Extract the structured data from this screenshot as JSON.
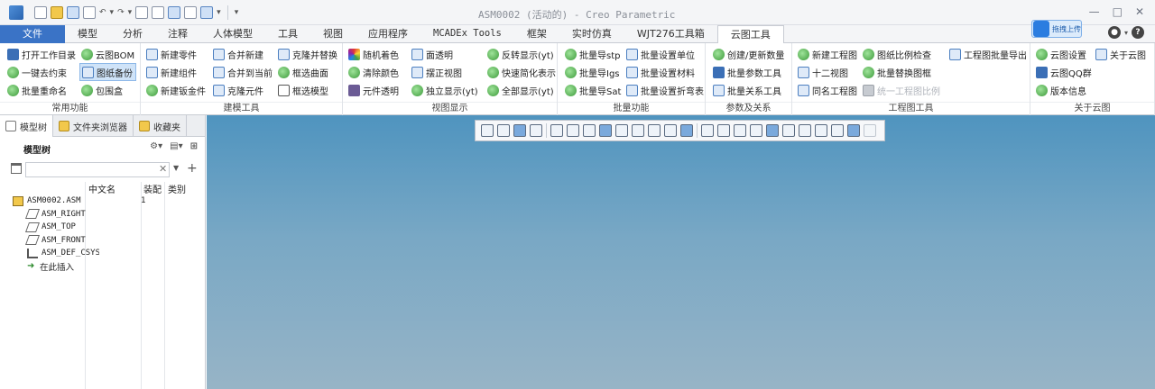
{
  "window": {
    "title": "ASM0002 (活动的) - Creo Parametric",
    "controls": [
      "—",
      "□",
      "✕"
    ]
  },
  "ribbon_tabs": [
    "文件",
    "模型",
    "分析",
    "注释",
    "人体模型",
    "工具",
    "视图",
    "应用程序",
    "MCADEx Tools",
    "框架",
    "实时仿真",
    "WJT276工具箱",
    "云图工具"
  ],
  "cloud_upload_label": "拖拽上传",
  "groups": [
    {
      "label": "常用功能",
      "cols": [
        [
          {
            "label": "打开工作目录",
            "icon": "bd"
          },
          {
            "label": "一键去约束",
            "icon": "g"
          },
          {
            "label": "批量重命名",
            "icon": "g"
          }
        ],
        [
          {
            "label": "云图BOM",
            "icon": "g"
          },
          {
            "label": "图纸备份",
            "icon": "bl",
            "selected": true
          },
          {
            "label": "包围盒",
            "icon": "g"
          }
        ]
      ]
    },
    {
      "label": "建模工具",
      "cols": [
        [
          {
            "label": "新建零件",
            "icon": "bl"
          },
          {
            "label": "新建组件",
            "icon": "bl"
          },
          {
            "label": "新建钣金件",
            "icon": "g"
          }
        ],
        [
          {
            "label": "合并新建",
            "icon": "bl"
          },
          {
            "label": "合并到当前",
            "icon": "bl"
          },
          {
            "label": "克隆元件",
            "icon": "bl"
          }
        ],
        [
          {
            "label": "克隆并替换",
            "icon": "bl"
          },
          {
            "label": "框选曲面",
            "icon": "g"
          },
          {
            "label": "框选模型",
            "icon": "pg"
          }
        ]
      ]
    },
    {
      "label": "视图显示",
      "cols": [
        [
          {
            "label": "随机着色",
            "icon": "rb"
          },
          {
            "label": "清除颜色",
            "icon": "g"
          },
          {
            "label": "元件透明",
            "icon": "pu"
          }
        ],
        [
          {
            "label": "面透明",
            "icon": "bl"
          },
          {
            "label": "摆正视图",
            "icon": "bl"
          },
          {
            "label": "独立显示(yt)",
            "icon": "g"
          }
        ],
        [
          {
            "label": "反转显示(yt)",
            "icon": "g"
          },
          {
            "label": "快速简化表示",
            "icon": "g"
          },
          {
            "label": "全部显示(yt)",
            "icon": "g"
          }
        ]
      ]
    },
    {
      "label": "批量功能",
      "cols": [
        [
          {
            "label": "批量导stp",
            "icon": "g"
          },
          {
            "label": "批量导Igs",
            "icon": "g"
          },
          {
            "label": "批量导Sat",
            "icon": "g"
          }
        ],
        [
          {
            "label": "批量设置单位",
            "icon": "bl"
          },
          {
            "label": "批量设置材料",
            "icon": "bl"
          },
          {
            "label": "批量设置折弯表",
            "icon": "bl"
          }
        ]
      ]
    },
    {
      "label": "参数及关系",
      "cols": [
        [
          {
            "label": "创建/更新数量",
            "icon": "g"
          },
          {
            "label": "批量参数工具",
            "icon": "bd"
          },
          {
            "label": "批量关系工具",
            "icon": "bl"
          }
        ]
      ]
    },
    {
      "label": "工程图工具",
      "cols": [
        [
          {
            "label": "新建工程图",
            "icon": "g"
          },
          {
            "label": "十二视图",
            "icon": "bl"
          },
          {
            "label": "同名工程图",
            "icon": "bl"
          }
        ],
        [
          {
            "label": "图纸比例检查",
            "icon": "g"
          },
          {
            "label": "批量替换图框",
            "icon": "g"
          },
          {
            "label": "统一工程图比例",
            "icon": "gr",
            "disabled": true
          }
        ],
        [
          {
            "label": "工程图批量导出",
            "icon": "bl"
          }
        ]
      ]
    },
    {
      "label": "关于云图",
      "cols": [
        [
          {
            "label": "云图设置",
            "icon": "g"
          },
          {
            "label": "云图QQ群",
            "icon": "bd"
          },
          {
            "label": "版本信息",
            "icon": "g"
          }
        ],
        [
          {
            "label": "关于云图",
            "icon": "bl"
          }
        ]
      ]
    }
  ],
  "panel_tabs": [
    "模型树",
    "文件夹浏览器",
    "收藏夹"
  ],
  "tree": {
    "title": "模型树",
    "columns": [
      "中文名",
      "装配",
      "类别"
    ],
    "rows": [
      {
        "label": "ASM0002.ASM",
        "icon": "asm",
        "value": "1"
      },
      {
        "label": "ASM_RIGHT",
        "icon": "plane"
      },
      {
        "label": "ASM_TOP",
        "icon": "plane"
      },
      {
        "label": "ASM_FRONT",
        "icon": "plane"
      },
      {
        "label": "ASM_DEF_CSYS",
        "icon": "csys"
      },
      {
        "label": "在此插入",
        "icon": "arrow"
      }
    ]
  },
  "filter": {
    "placeholder": ""
  },
  "view_toolbar": {
    "count": 24
  }
}
